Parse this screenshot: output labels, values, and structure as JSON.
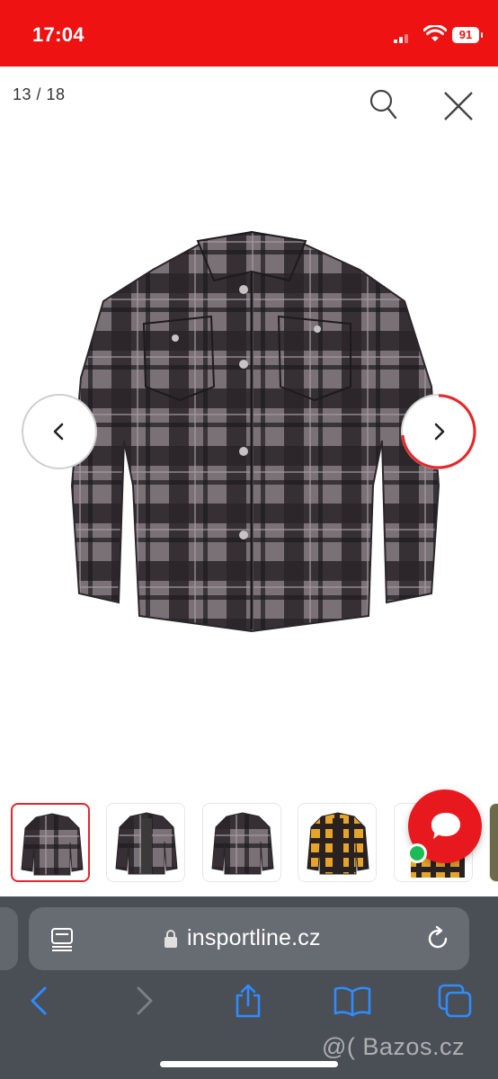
{
  "status_bar": {
    "time": "17:04",
    "battery_level": "91",
    "accent_color": "#ee1212"
  },
  "viewer": {
    "counter": "13 / 18",
    "search_icon": "search-icon",
    "close_icon": "close-icon",
    "main_image": "grey-black-plaid-shirt",
    "prev_icon": "chevron-left-icon",
    "next_icon": "chevron-right-icon"
  },
  "thumbnails": [
    {
      "name": "grey-plaid-shirt-front",
      "active": true
    },
    {
      "name": "grey-plaid-shirt-open",
      "active": false
    },
    {
      "name": "grey-plaid-shirt-back",
      "active": false
    },
    {
      "name": "yellow-plaid-shirt-front",
      "active": false
    },
    {
      "name": "yellow-plaid-shirt-partial",
      "active": false
    },
    {
      "name": "camo-partial",
      "active": false
    }
  ],
  "chat": {
    "icon": "chat-bubble-icon",
    "status": "online",
    "color": "#e8191e"
  },
  "browser": {
    "url": "insportline.cz",
    "toolbar": [
      "back-icon",
      "forward-icon",
      "share-icon",
      "bookmarks-icon",
      "tabs-icon"
    ],
    "watermark": "@( Bazos.cz"
  }
}
